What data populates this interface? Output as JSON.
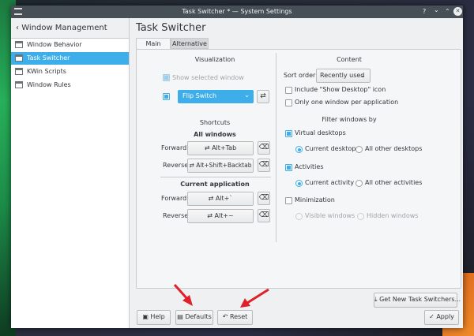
{
  "window": {
    "title": "Task Switcher * — System Settings",
    "controls": {
      "help": "?",
      "minimize": "⌄",
      "maximize": "⌃",
      "close": "✕"
    }
  },
  "sidebar": {
    "back_label": "Window Management",
    "items": [
      {
        "label": "Window Behavior"
      },
      {
        "label": "Task Switcher",
        "selected": true
      },
      {
        "label": "KWin Scripts"
      },
      {
        "label": "Window Rules"
      }
    ]
  },
  "page": {
    "title": "Task Switcher",
    "tabs": [
      {
        "label": "Main",
        "active": true
      },
      {
        "label": "Alternative"
      }
    ]
  },
  "visualization": {
    "heading": "Visualization",
    "show_selected_window": {
      "label": "Show selected window",
      "checked": true,
      "disabled": true
    },
    "effect_enabled": true,
    "effect": "Flip Switch"
  },
  "shortcuts": {
    "heading": "Shortcuts",
    "all_windows": {
      "heading": "All windows",
      "forward_label": "Forward",
      "forward": "Alt+Tab",
      "reverse_label": "Reverse",
      "reverse": "Alt+Shift+Backtab"
    },
    "current_application": {
      "heading": "Current application",
      "forward_label": "Forward",
      "forward": "Alt+`",
      "reverse_label": "Reverse",
      "reverse": "Alt+~"
    }
  },
  "content": {
    "heading": "Content",
    "sort_label": "Sort order:",
    "sort_value": "Recently used",
    "include_desktop": {
      "label": "Include \"Show Desktop\" icon",
      "checked": false
    },
    "one_per_app": {
      "label": "Only one window per application",
      "checked": false
    }
  },
  "filter": {
    "heading": "Filter windows by",
    "virtual_desktops": {
      "label": "Virtual desktops",
      "checked": true,
      "current": "Current desktop",
      "other": "All other desktops"
    },
    "activities": {
      "label": "Activities",
      "checked": true,
      "current": "Current activity",
      "other": "All other activities"
    },
    "minimization": {
      "label": "Minimization",
      "checked": false,
      "visible": "Visible windows",
      "hidden": "Hidden windows"
    }
  },
  "footer": {
    "get_new": "Get New Task Switchers...",
    "help": "Help",
    "defaults": "Defaults",
    "reset": "Reset",
    "apply": "Apply"
  },
  "colors": {
    "accent": "#3daee9",
    "annotation": "#e0202a"
  }
}
